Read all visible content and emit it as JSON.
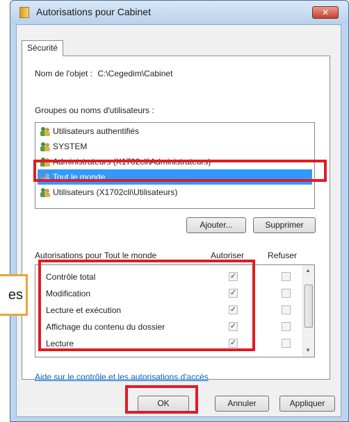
{
  "window": {
    "title": "Autorisations pour Cabinet",
    "close_glyph": "✕"
  },
  "tab": {
    "label": "Sécurité"
  },
  "object": {
    "label": "Nom de l'objet :",
    "value": "C:\\Cegedim\\Cabinet"
  },
  "groups": {
    "label": "Groupes ou noms d'utilisateurs :",
    "items": [
      {
        "label": "Utilisateurs authentifiés",
        "icon": "users-icon"
      },
      {
        "label": "SYSTEM",
        "icon": "users-icon"
      },
      {
        "label": "Administrateurs (X1702cli\\Administrateurs)",
        "icon": "users-icon"
      },
      {
        "label": "Tout le monde",
        "icon": "users-icon",
        "selected": true
      },
      {
        "label": "Utilisateurs (X1702cli\\Utilisateurs)",
        "icon": "users-icon"
      }
    ],
    "add_button": "Ajouter...",
    "remove_button": "Supprimer"
  },
  "permissions": {
    "header": "Autorisations pour Tout le monde",
    "allow_header": "Autoriser",
    "deny_header": "Refuser",
    "check_glyph": "✓",
    "rows": [
      {
        "name": "Contrôle total",
        "allow": true,
        "deny": false
      },
      {
        "name": "Modification",
        "allow": true,
        "deny": false
      },
      {
        "name": "Lecture et exécution",
        "allow": true,
        "deny": false
      },
      {
        "name": "Affichage du contenu du dossier",
        "allow": true,
        "deny": false
      },
      {
        "name": "Lecture",
        "allow": true,
        "deny": false
      }
    ]
  },
  "help_link": "Aide sur le contrôle et les autorisations d'accès",
  "buttons": {
    "ok": "OK",
    "cancel": "Annuler",
    "apply": "Appliquer"
  },
  "callout": {
    "text": "es"
  },
  "colors": {
    "highlight": "#e01c24",
    "selection": "#3399ff",
    "callout_border": "#e9a43a",
    "link": "#0066cc"
  }
}
